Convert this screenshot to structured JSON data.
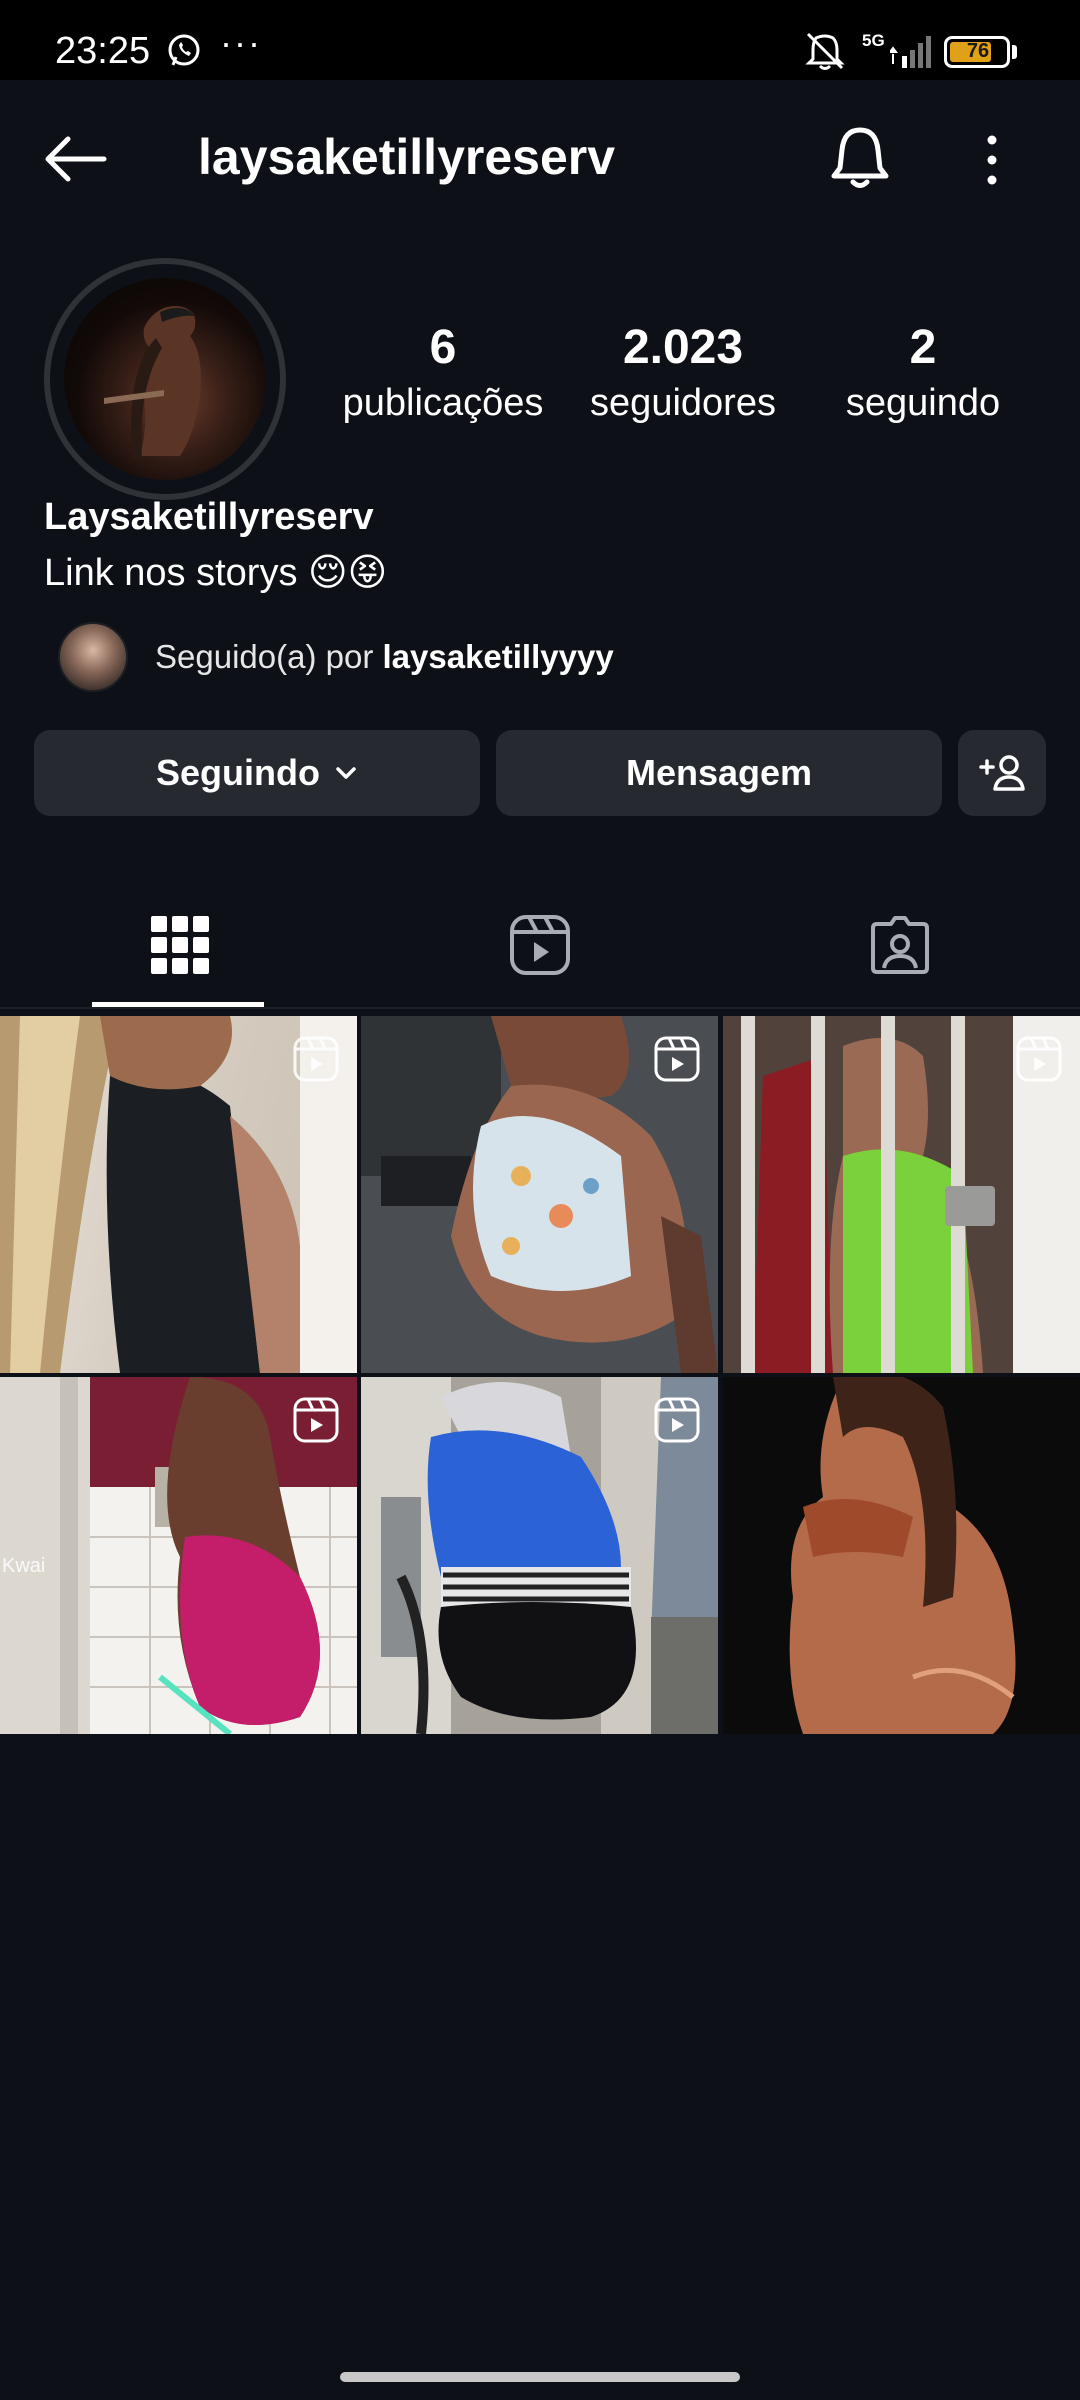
{
  "status_bar": {
    "time": "23:25",
    "more_dots": "···",
    "network": "5G",
    "battery": "76",
    "battery_level": 0.76
  },
  "header": {
    "username": "laysaketillyreserv"
  },
  "profile": {
    "stats": [
      {
        "value": "6",
        "label": "publicações"
      },
      {
        "value": "2.023",
        "label": "seguidores"
      },
      {
        "value": "2",
        "label": "seguindo"
      }
    ],
    "display_name": "Laysaketillyreserv",
    "bio": "Link nos storys 😌😝",
    "followed_by_prefix": "Seguido(a) por ",
    "followed_by_user": "laysaketillyyyy"
  },
  "buttons": {
    "following": "Seguindo",
    "message": "Mensagem"
  },
  "tabs": [
    {
      "icon": "grid-icon",
      "active": true
    },
    {
      "icon": "reels-icon",
      "active": false
    },
    {
      "icon": "tagged-icon",
      "active": false
    }
  ],
  "posts": [
    {
      "type": "reel"
    },
    {
      "type": "reel"
    },
    {
      "type": "reel"
    },
    {
      "type": "reel",
      "overlay_text": "Kwai"
    },
    {
      "type": "reel"
    },
    {
      "type": "photo"
    }
  ],
  "colors": {
    "background": "#0d1117",
    "button": "#262a30",
    "battery": "#e0a118"
  }
}
